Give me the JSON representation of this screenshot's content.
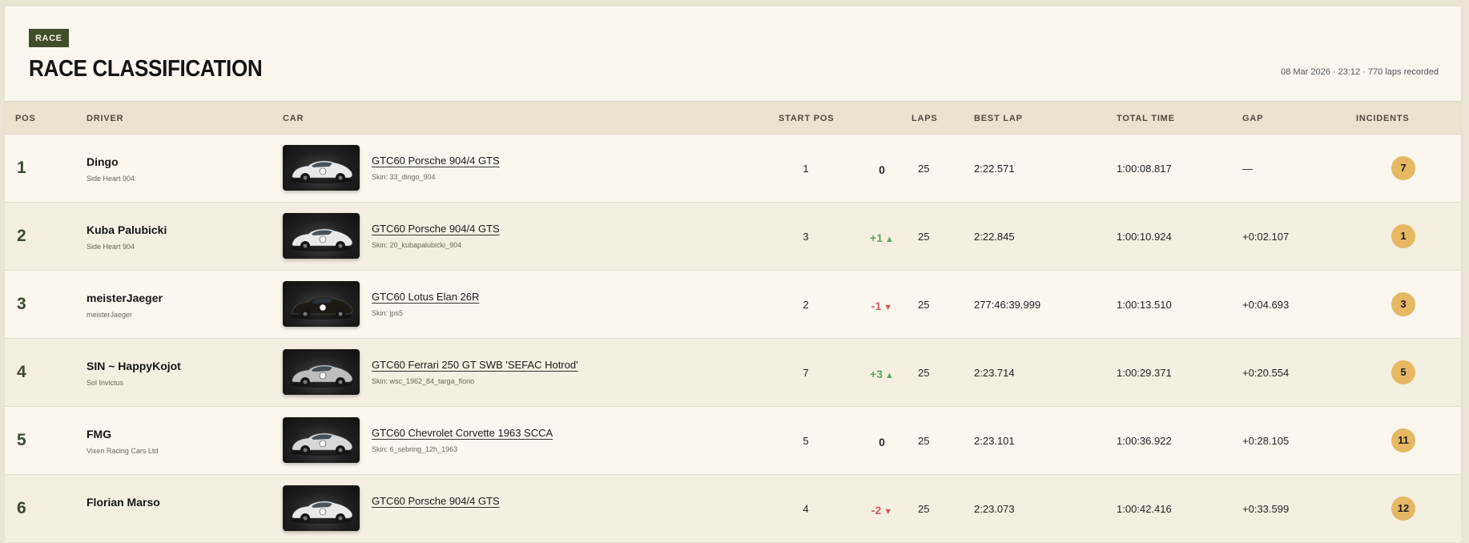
{
  "header": {
    "badge": "RACE",
    "title": "RACE CLASSIFICATION",
    "meta": "08 Mar 2026 · 23:12 · 770 laps recorded"
  },
  "columns": {
    "pos": "POS",
    "driver": "DRIVER",
    "car": "CAR",
    "start_pos": "START POS",
    "laps": "LAPS",
    "best_lap": "BEST LAP",
    "total_time": "TOTAL TIME",
    "gap": "GAP",
    "incidents": "INCIDENTS"
  },
  "colors": {
    "accent": "#3f4f2c",
    "gain": "#5aa35f",
    "loss": "#d0585e",
    "incident_badge": "#e6b863"
  },
  "rows": [
    {
      "pos": "1",
      "driver": "Dingo",
      "team": "Side Heart 904",
      "car": "GTC60 Porsche 904/4 GTS",
      "skin": "Skin: 33_dingo_904",
      "car_color": "#e9e9e9",
      "start": "1",
      "change": "0",
      "change_dir": "zero",
      "laps": "25",
      "best": "2:22.571",
      "total": "1:00:08.817",
      "gap": "—",
      "incidents": "7"
    },
    {
      "pos": "2",
      "driver": "Kuba Palubicki",
      "team": "Side Heart 904",
      "car": "GTC60 Porsche 904/4 GTS",
      "skin": "Skin: 20_kubapalubicki_904",
      "car_color": "#e9e9e9",
      "start": "3",
      "change": "+1",
      "change_dir": "up",
      "laps": "25",
      "best": "2:22.845",
      "total": "1:00:10.924",
      "gap": "+0:02.107",
      "incidents": "1"
    },
    {
      "pos": "3",
      "driver": "meisterJaeger",
      "team": "meisterJaeger",
      "car": "GTC60 Lotus Elan 26R",
      "skin": "Skin: jps5",
      "car_color": "#1d1a14",
      "start": "2",
      "change": "-1",
      "change_dir": "down",
      "laps": "25",
      "best": "277:46:39.999",
      "total": "1:00:13.510",
      "gap": "+0:04.693",
      "incidents": "3"
    },
    {
      "pos": "4",
      "driver": "SIN ~ HappyKojot",
      "team": "Sol Invictus",
      "car": "GTC60 Ferrari 250 GT SWB 'SEFAC Hotrod'",
      "skin": "Skin: wsc_1962_84_targa_florio",
      "car_color": "#bdbdbd",
      "start": "7",
      "change": "+3",
      "change_dir": "up",
      "laps": "25",
      "best": "2:23.714",
      "total": "1:00:29.371",
      "gap": "+0:20.554",
      "incidents": "5"
    },
    {
      "pos": "5",
      "driver": "FMG",
      "team": "Vixen Racing Cars Ltd",
      "car": "GTC60 Chevrolet Corvette 1963 SCCA",
      "skin": "Skin: 6_sebring_12h_1963",
      "car_color": "#d8d8d8",
      "start": "5",
      "change": "0",
      "change_dir": "zero",
      "laps": "25",
      "best": "2:23.101",
      "total": "1:00:36.922",
      "gap": "+0:28.105",
      "incidents": "11"
    },
    {
      "pos": "6",
      "driver": "Florian Marso",
      "team": "",
      "car": "GTC60 Porsche 904/4 GTS",
      "skin": "",
      "car_color": "#e9e9e9",
      "start": "4",
      "change": "-2",
      "change_dir": "down",
      "laps": "25",
      "best": "2:23.073",
      "total": "1:00:42.416",
      "gap": "+0:33.599",
      "incidents": "12"
    }
  ]
}
